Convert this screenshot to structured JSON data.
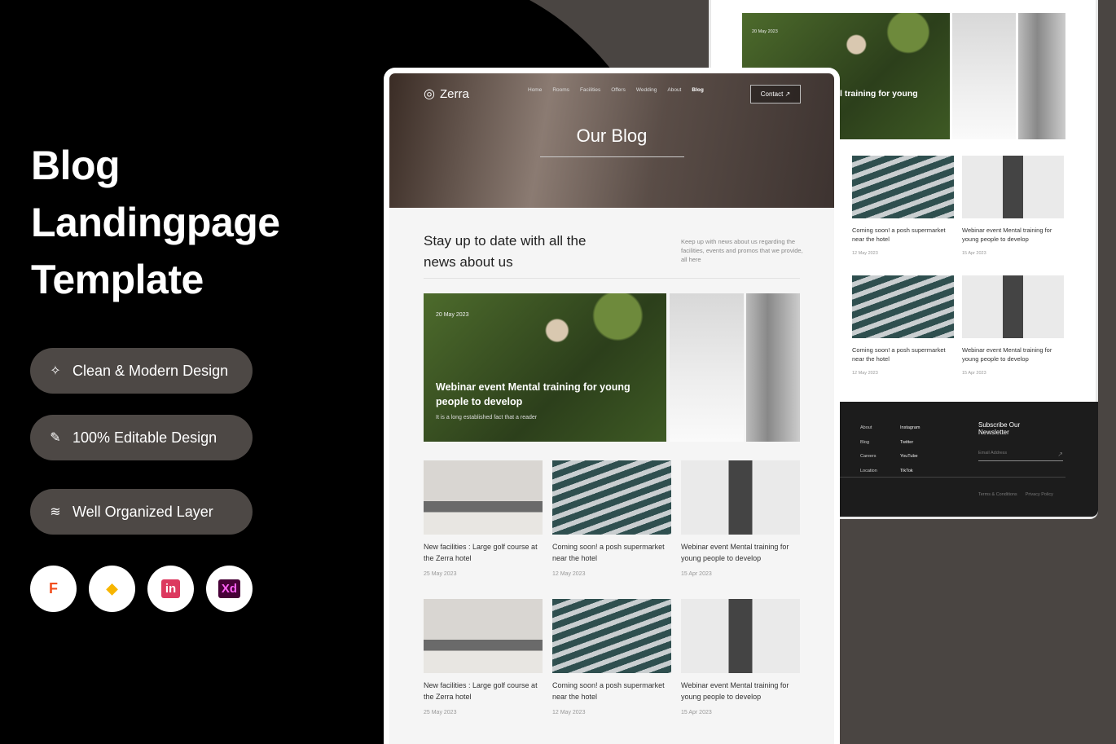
{
  "promo": {
    "title_lines": [
      "Blog",
      "Landingpage",
      "Template"
    ],
    "features": [
      {
        "icon": "magic-wand-icon",
        "label": "Clean & Modern Design"
      },
      {
        "icon": "pen-tool-icon",
        "label": "100% Editable Design"
      },
      {
        "icon": "layers-icon",
        "label": "Well Organized Layer"
      }
    ],
    "apps": [
      {
        "name": "figma-icon",
        "glyph": "F"
      },
      {
        "name": "sketch-icon",
        "glyph": "◆"
      },
      {
        "name": "invision-icon",
        "glyph": "in"
      },
      {
        "name": "xd-icon",
        "glyph": "Xd"
      }
    ]
  },
  "site": {
    "brand": "Zerra",
    "nav": [
      "Home",
      "Rooms",
      "Facilities",
      "Offers",
      "Wedding",
      "About",
      "Blog"
    ],
    "active_nav": "Blog",
    "contact_label": "Contact ↗",
    "page_title": "Our Blog",
    "intro_heading": "Stay up to date with all the news about us",
    "intro_text": "Keep up with news about us regarding the facilities, events and promos that we provide, all here",
    "featured": {
      "date": "20 May 2023",
      "title": "Webinar event Mental training for young people to develop",
      "subtitle": "It is a long established fact that a reader"
    },
    "posts": [
      {
        "title": "New facilities : Large golf course at the Zerra hotel",
        "date": "25 May 2023"
      },
      {
        "title": "Coming soon! a posh supermarket near the hotel",
        "date": "12 May 2023"
      },
      {
        "title": "Webinar event Mental training for young people to develop",
        "date": "15 Apr 2023"
      },
      {
        "title": "New facilities : Large golf course at the Zerra hotel",
        "date": "25 May 2023"
      },
      {
        "title": "Coming soon! a posh supermarket near the hotel",
        "date": "12 May 2023"
      },
      {
        "title": "Webinar event Mental training for young people to develop",
        "date": "15 Apr 2023"
      }
    ]
  },
  "back": {
    "featured_date": "20 May 2023",
    "featured_title": "l training for young",
    "footer": {
      "col1": [
        "About",
        "Blog",
        "Careers",
        "Location"
      ],
      "col2": [
        "Instagram",
        "Twitter",
        "YouTube",
        "TikTok"
      ],
      "newsletter_title": "Subscribe Our Newsletter",
      "email_placeholder": "Email Address",
      "links": [
        "Terms & Conditions",
        "Privacy Policy"
      ]
    }
  }
}
